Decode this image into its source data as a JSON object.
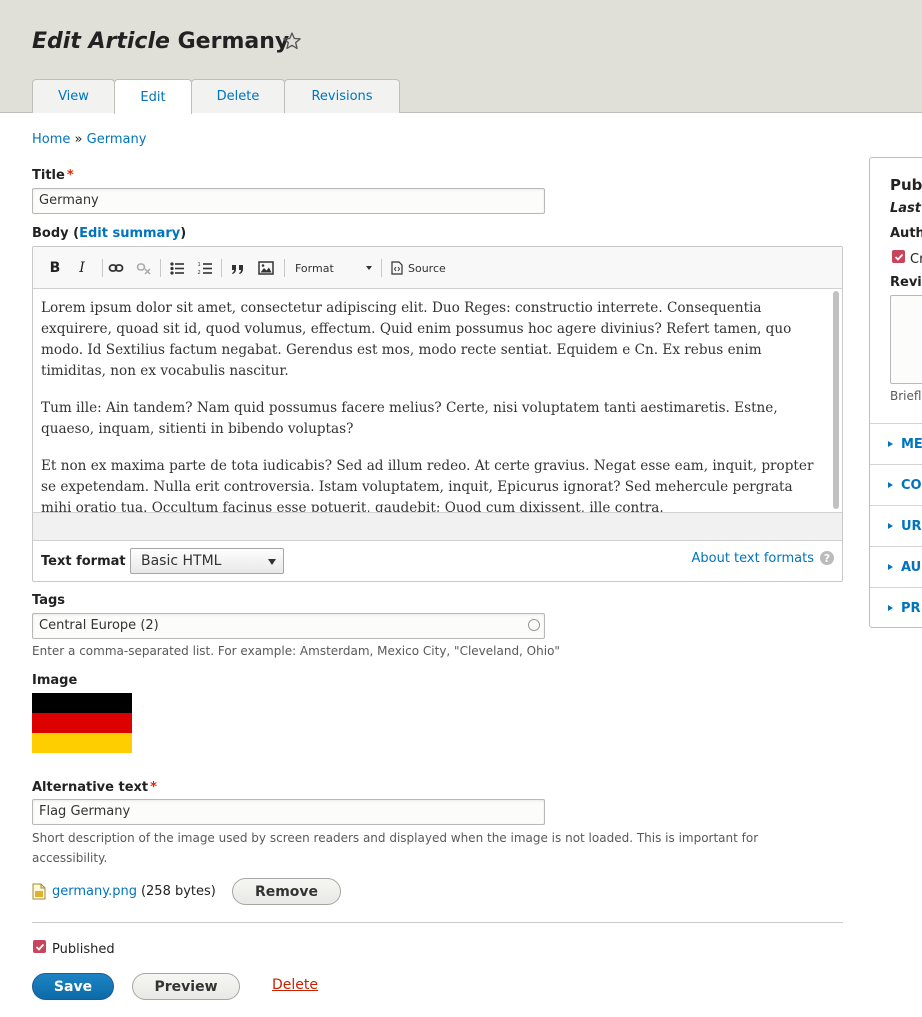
{
  "header": {
    "title_italic": "Edit Article",
    "title_rest": "Germany",
    "tabs": [
      {
        "label": "View"
      },
      {
        "label": "Edit"
      },
      {
        "label": "Delete"
      },
      {
        "label": "Revisions"
      }
    ]
  },
  "breadcrumb": {
    "home": "Home",
    "sep": "»",
    "current": "Germany"
  },
  "title_field": {
    "label": "Title",
    "required_mark": "*",
    "value": "Germany"
  },
  "body_field": {
    "label_prefix": "Body (",
    "edit_summary": "Edit summary",
    "label_suffix": ")",
    "toolbar": {
      "bold": "B",
      "italic": "I",
      "format": "Format",
      "source": "Source"
    },
    "paragraphs": [
      "Lorem ipsum dolor sit amet, consectetur adipiscing elit. Duo Reges: constructio interrete. Consequentia exquirere, quoad sit id, quod volumus, effectum. Quid enim possumus hoc agere divinius? Refert tamen, quo modo. Id Sextilius factum negabat. Gerendus est mos, modo recte sentiat. Equidem e Cn. Ex rebus enim timiditas, non ex vocabulis nascitur.",
      "Tum ille: Ain tandem? Nam quid possumus facere melius? Certe, nisi voluptatem tanti aestimaretis. Estne, quaeso, inquam, sitienti in bibendo voluptas?",
      "Et non ex maxima parte de tota iudicabis? Sed ad illum redeo. At certe gravius. Negat esse eam, inquit, propter se expetendam. Nulla erit controversia. Istam voluptatem, inquit, Epicurus ignorat? Sed mehercule pergrata mihi oratio tua. Occultum facinus esse potuerit, gaudebit; Quod cum dixissent, ille contra."
    ],
    "text_format_label": "Text format",
    "text_format_value": "Basic HTML",
    "about_formats": "About text formats",
    "help": "?"
  },
  "tags_field": {
    "label": "Tags",
    "value": "Central Europe (2)",
    "description": "Enter a comma-separated list. For example: Amsterdam, Mexico City, \"Cleveland, Ohio\""
  },
  "image_field": {
    "label": "Image",
    "flag_colors": [
      "#000000",
      "#dd0000",
      "#ffce00"
    ],
    "alt_label": "Alternative text",
    "alt_required": "*",
    "alt_value": "Flag Germany",
    "alt_description": "Short description of the image used by screen readers and displayed when the image is not loaded. This is important for accessibility.",
    "file_name": "germany.png",
    "file_size": "(258 bytes)",
    "remove_label": "Remove"
  },
  "published": {
    "label": "Published"
  },
  "actions": {
    "save": "Save",
    "preview": "Preview",
    "delete": "Delete"
  },
  "sidebar": {
    "heading": "Pub",
    "last": "Last",
    "author": "Auth",
    "create_revision": "Cr",
    "revision": "Revi",
    "brief": "Briefl",
    "details": [
      {
        "label": "ME"
      },
      {
        "label": "CO"
      },
      {
        "label": "UR"
      },
      {
        "label": "AU"
      },
      {
        "label": "PR"
      }
    ]
  },
  "colors": {
    "link": "#0074bd",
    "primary_button": "#0c6aa8",
    "required": "#e32700",
    "checkbox": "#c9455b",
    "delete_link": "#c72100"
  }
}
